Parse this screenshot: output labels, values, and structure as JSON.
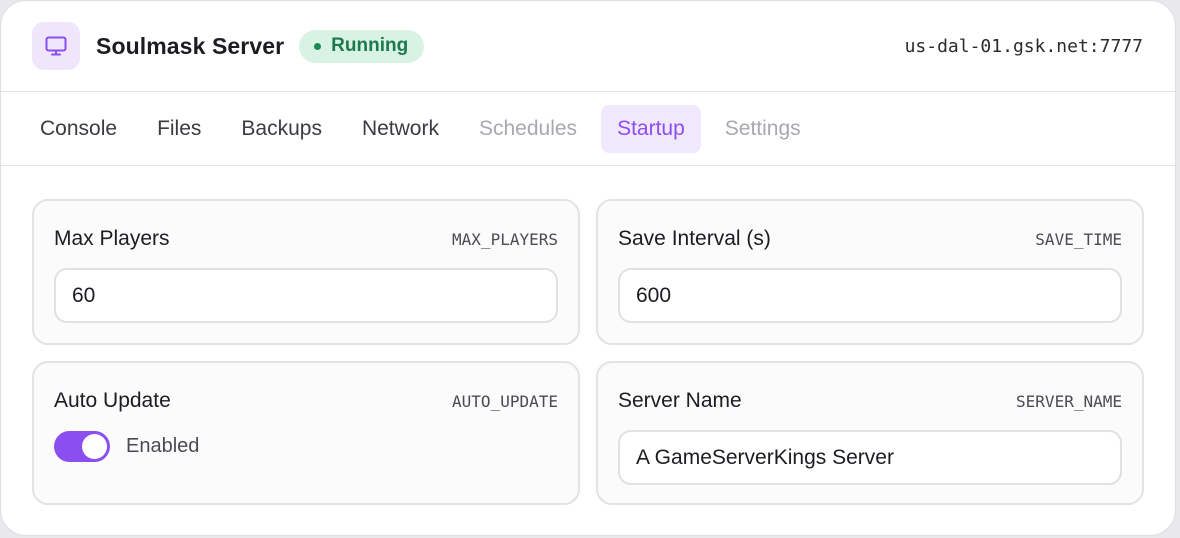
{
  "header": {
    "icon": "monitor-icon",
    "title": "Soulmask Server",
    "status": "Running",
    "status_color": "#1c7a4c",
    "address": "us-dal-01.gsk.net:7777"
  },
  "tabs": [
    {
      "label": "Console",
      "state": "enabled"
    },
    {
      "label": "Files",
      "state": "enabled"
    },
    {
      "label": "Backups",
      "state": "enabled"
    },
    {
      "label": "Network",
      "state": "enabled"
    },
    {
      "label": "Schedules",
      "state": "disabled"
    },
    {
      "label": "Startup",
      "state": "active"
    },
    {
      "label": "Settings",
      "state": "disabled"
    }
  ],
  "accent_color": "#8b4ef0",
  "variables": {
    "max_players": {
      "label": "Max Players",
      "key": "MAX_PLAYERS",
      "value": "60"
    },
    "save_interval": {
      "label": "Save Interval (s)",
      "key": "SAVE_TIME",
      "value": "600"
    },
    "auto_update": {
      "label": "Auto Update",
      "key": "AUTO_UPDATE",
      "toggle_on": true,
      "toggle_label": "Enabled"
    },
    "server_name": {
      "label": "Server Name",
      "key": "SERVER_NAME",
      "value": "A GameServerKings Server"
    }
  }
}
